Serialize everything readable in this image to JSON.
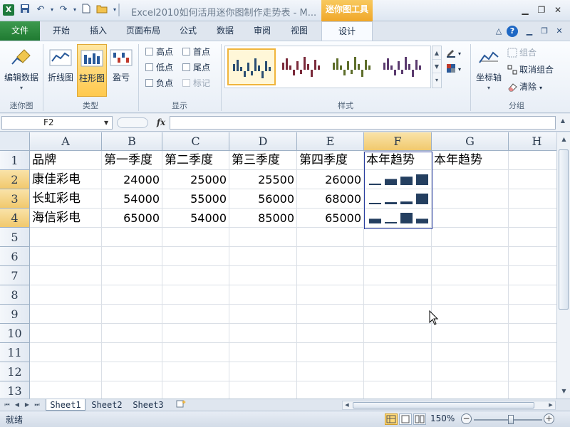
{
  "window": {
    "title": "Excel2010如何活用迷你图制作走势表 - M...",
    "context_tool_title": "迷你图工具",
    "logo": "X",
    "controls": [
      "minimize-icon",
      "restore-icon",
      "close-icon"
    ]
  },
  "ribbon_tabs": [
    "文件",
    "开始",
    "插入",
    "页面布局",
    "公式",
    "数据",
    "审阅",
    "视图",
    "设计"
  ],
  "ribbon": {
    "groups": {
      "sparkline": "迷你图",
      "type": "类型",
      "show": "显示",
      "style": "样式",
      "group": "分组"
    },
    "edit_data": "编辑数据",
    "type_buttons": [
      "折线图",
      "柱形图",
      "盈亏"
    ],
    "selected_type": "柱形图",
    "show_options": [
      {
        "label": "高点",
        "checked": false,
        "enabled": true
      },
      {
        "label": "首点",
        "checked": false,
        "enabled": true
      },
      {
        "label": "低点",
        "checked": false,
        "enabled": true
      },
      {
        "label": "尾点",
        "checked": false,
        "enabled": true
      },
      {
        "label": "负点",
        "checked": false,
        "enabled": true
      },
      {
        "label": "标记",
        "checked": false,
        "enabled": false
      }
    ],
    "style_colors": [
      "#2a4d72",
      "#7a2a3a",
      "#5d6d2a",
      "#5a3a6e"
    ],
    "axis_label": "坐标轴",
    "group_button": "组合",
    "ungroup_button": "取消组合",
    "clear_button": "清除"
  },
  "formula_bar": {
    "name_box": "F2",
    "fx_label": "fx",
    "value": ""
  },
  "sheet": {
    "columns": [
      "A",
      "B",
      "C",
      "D",
      "E",
      "F",
      "G",
      "H"
    ],
    "rows": [
      "1",
      "2",
      "3",
      "4",
      "5",
      "6",
      "7",
      "8",
      "9",
      "10",
      "11",
      "12",
      "13"
    ],
    "active_column": "F",
    "active_rows": [
      "2",
      "3",
      "4"
    ],
    "header_row": [
      "品牌",
      "第一季度",
      "第二季度",
      "第三季度",
      "第四季度",
      "本年趋势",
      "本年趋势"
    ],
    "data_rows": [
      {
        "brand": "康佳彩电",
        "values": [
          "24000",
          "25000",
          "25500",
          "26000"
        ],
        "numbers": [
          24000,
          25000,
          25500,
          26000
        ]
      },
      {
        "brand": "长虹彩电",
        "values": [
          "54000",
          "55000",
          "56000",
          "68000"
        ],
        "numbers": [
          54000,
          55000,
          56000,
          68000
        ]
      },
      {
        "brand": "海信彩电",
        "values": [
          "65000",
          "54000",
          "85000",
          "65000"
        ],
        "numbers": [
          65000,
          54000,
          85000,
          65000
        ]
      }
    ],
    "sparkline_color": "#243f60"
  },
  "sheet_tabs": [
    "Sheet1",
    "Sheet2",
    "Sheet3"
  ],
  "status_bar": {
    "status": "就绪",
    "zoom": "150%",
    "zoom_minus": "−",
    "zoom_plus": "+"
  }
}
